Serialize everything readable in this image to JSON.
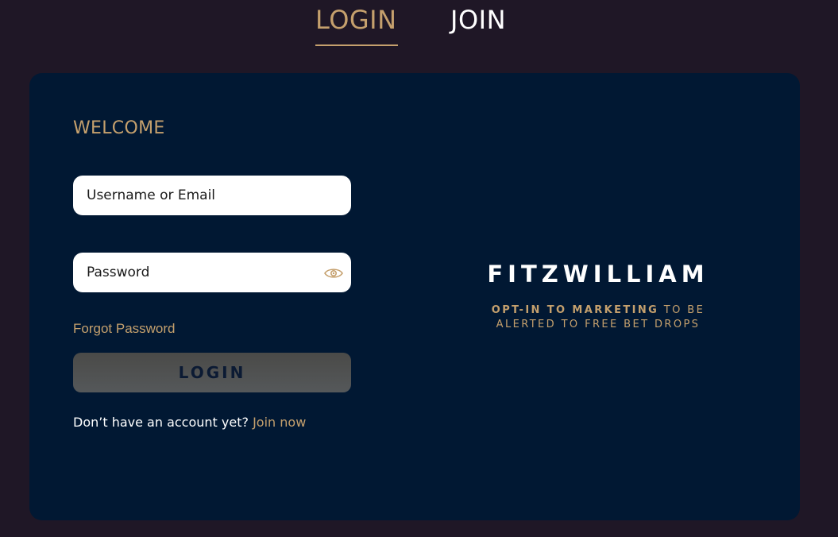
{
  "tabs": {
    "login": "LOGIN",
    "join": "JOIN",
    "active": "login"
  },
  "form": {
    "welcome": "WELCOME",
    "username_placeholder": "Username or Email",
    "password_placeholder": "Password",
    "forgot": "Forgot Password",
    "submit": "LOGIN",
    "no_account": "Don’t have an account yet?",
    "join_now": "Join now",
    "password_toggle_icon": "eye-icon"
  },
  "brand": {
    "name": "FITZWILLIAM",
    "tagline_bold": "OPT-IN TO MARKETING",
    "tagline_rest": " TO BE",
    "tagline_line2": "ALERTED TO FREE BET DROPS"
  },
  "colors": {
    "background": "#1f1726",
    "card": "#011833",
    "accent_gold": "#c5a06d",
    "button": "#4f5151"
  }
}
